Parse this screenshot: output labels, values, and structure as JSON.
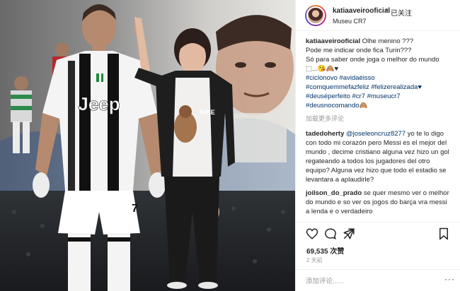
{
  "post": {
    "username": "katiaaveirooficial",
    "follow_status": "已关注",
    "location": "Museu CR7",
    "caption_lines": [
      "Olhe menino ???",
      "Pode me indicar onde fica Turin???",
      "Só para saber onde joga o melhor do mundo ⬚...😘🙈♥"
    ],
    "hashtags": [
      "#ciclonovo #avidaéisso",
      "#comquemmefazfeliz #felizerealizada♥",
      "#deuséperfeito #cr7 #museucr7",
      "#deusnocomando🙈"
    ],
    "translate": "加载更多评论"
  },
  "comments": [
    {
      "user": "tadedoherty",
      "mention": "@joseleoncruz8277",
      "text": "yo te lo digo con todo mi corazón pero Messi es el mejor del mundo , decime cristiano alguna vez hizo un gol regateando a todos los jugadores del otro equipo? Alguna vez hizo que todo el estadio se levantara a aplaudirle?"
    },
    {
      "user": "joilson_do_prado",
      "text": "se quer mesmo ver o melhor do mundo e so ver os jogos do barça vra messi a lenda e o verdadeiro"
    }
  ],
  "stats": {
    "likes_count": "69,535",
    "likes_word": "次赞",
    "time_ago": "2 天前"
  },
  "composer": {
    "placeholder": "添加评论......",
    "options": "···"
  },
  "photo": {
    "jersey_sponsor": "Jeep",
    "shirt_brand": "NIKE",
    "shorts_number": "7"
  },
  "colors": {
    "link": "#003569",
    "muted": "#999999",
    "text": "#262626",
    "border": "#efefef"
  },
  "icons": [
    "heart-icon",
    "comment-icon",
    "share-icon",
    "bookmark-icon"
  ]
}
